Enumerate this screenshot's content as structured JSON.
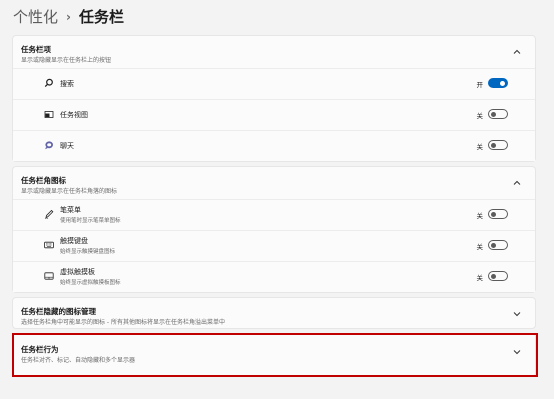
{
  "breadcrumb": {
    "parent": "个性化",
    "separator": "›",
    "current": "任务栏"
  },
  "sections": {
    "taskbar_items": {
      "title": "任务栏项",
      "subtitle": "显示或隐藏显示在任务栏上的按钮",
      "expanded": true,
      "items": [
        {
          "label": "搜索",
          "state": "开",
          "on": true,
          "icon": "search-icon"
        },
        {
          "label": "任务视图",
          "state": "关",
          "on": false,
          "icon": "task-view-icon"
        },
        {
          "label": "聊天",
          "state": "关",
          "on": false,
          "icon": "chat-icon"
        }
      ]
    },
    "corner_icons": {
      "title": "任务栏角图标",
      "subtitle": "显示或隐藏显示在任务栏角落的图标",
      "expanded": true,
      "items": [
        {
          "label": "笔菜单",
          "desc": "使用笔时显示笔菜单图标",
          "state": "关",
          "on": false,
          "icon": "pen-icon"
        },
        {
          "label": "触摸键盘",
          "desc": "始终显示触摸键盘图标",
          "state": "关",
          "on": false,
          "icon": "keyboard-icon"
        },
        {
          "label": "虚拟触摸板",
          "desc": "始终显示虚拟触摸板图标",
          "state": "关",
          "on": false,
          "icon": "touchpad-icon"
        }
      ]
    },
    "hidden_icons": {
      "title": "任务栏隐藏的图标管理",
      "subtitle": "选择任务栏角中可能显示的图标 - 所有其他图标将显示在任务栏角溢出菜单中",
      "expanded": false
    },
    "behaviors": {
      "title": "任务栏行为",
      "subtitle": "任务栏对齐、标记、自动隐藏和多个显示器",
      "expanded": false
    }
  },
  "colors": {
    "accent": "#0067c0",
    "highlight": "#c00000"
  }
}
